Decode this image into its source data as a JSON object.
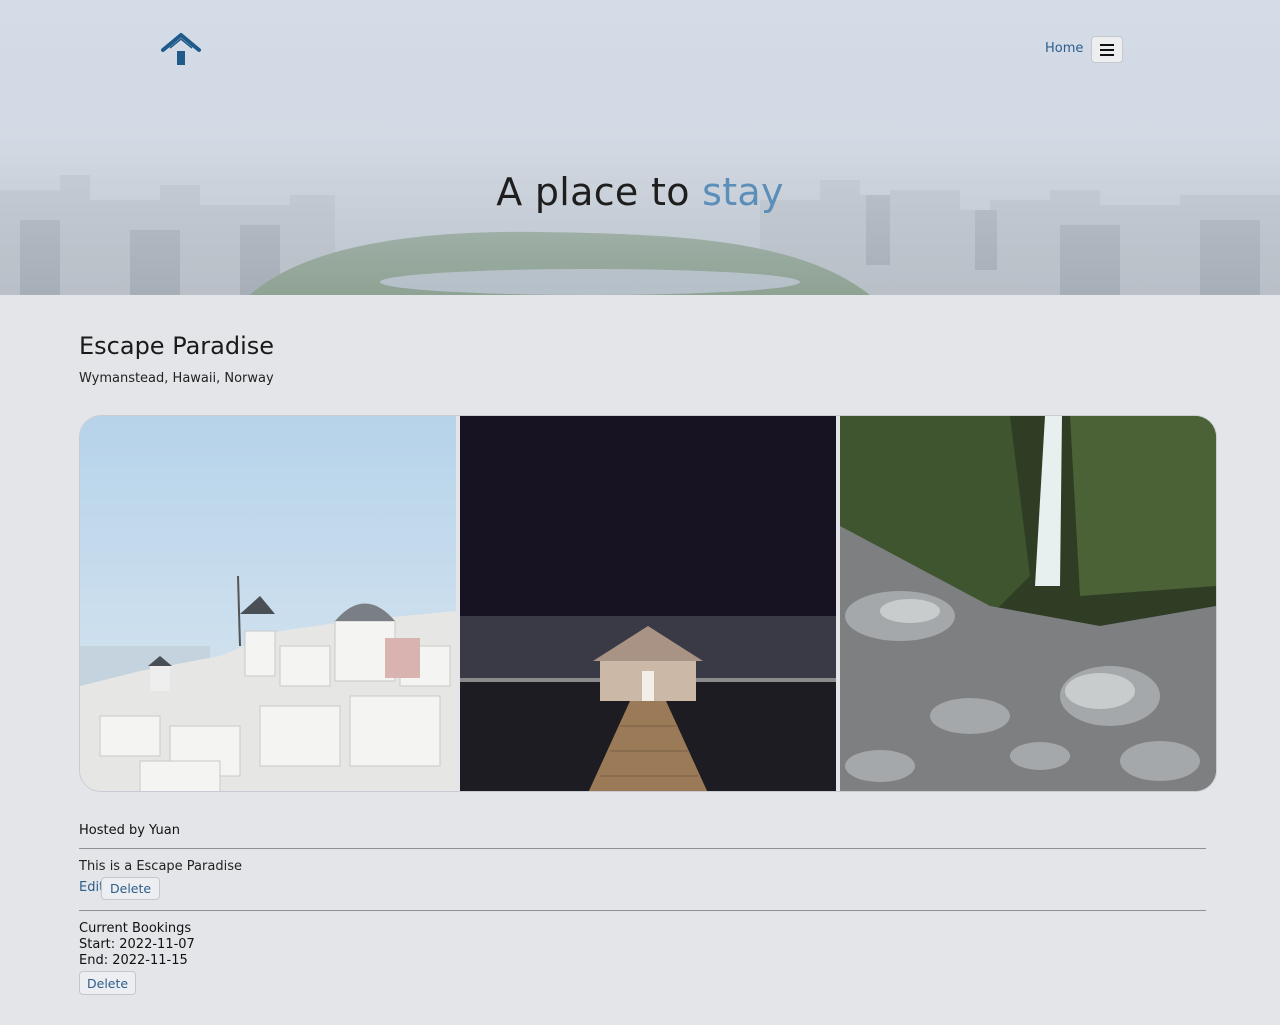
{
  "header": {
    "nav_home": "Home",
    "title_main": "A place to ",
    "title_accent": "stay",
    "accent_color": "#5b8fb9",
    "logo_icon": "house-icon",
    "menu_icon": "hamburger-menu-icon"
  },
  "listing": {
    "title": "Escape Paradise",
    "location": "Wymanstead, Hawaii, Norway",
    "images": [
      {
        "name": "santorini-photo"
      },
      {
        "name": "boathouse-night-photo"
      },
      {
        "name": "waterfall-rocks-photo"
      }
    ],
    "host": "Hosted by Yuan",
    "description": "This is a Escape Paradise",
    "edit_label": "Edit",
    "delete_label": "Delete"
  },
  "bookings": {
    "heading": "Current Bookings",
    "items": [
      {
        "start": "Start: 2022-11-07",
        "end": "End: 2022-11-15",
        "delete_label": "Delete"
      }
    ]
  }
}
